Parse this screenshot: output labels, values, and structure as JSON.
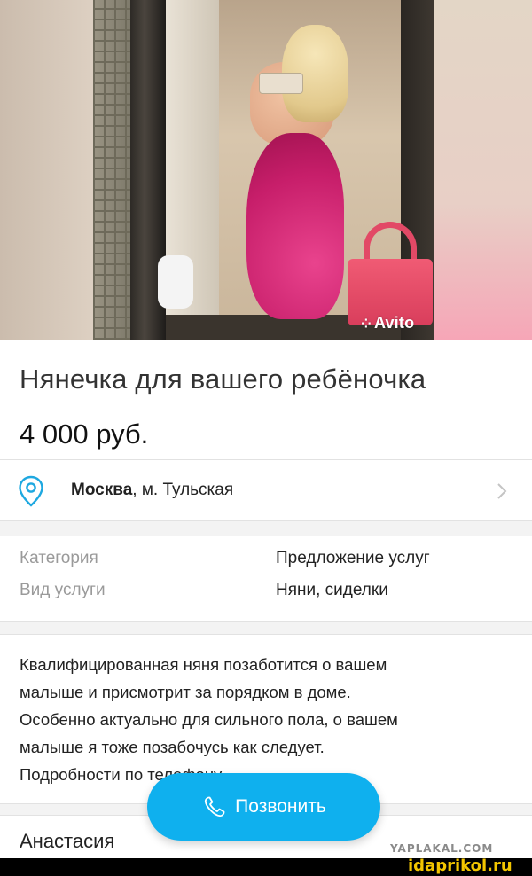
{
  "photo": {
    "watermark": "Avito",
    "watermark_icon": "avito-dots-icon"
  },
  "listing": {
    "title": "Нянечка для вашего ребёночка",
    "price": "4 000 руб."
  },
  "location": {
    "city": "Москва",
    "metro": ", м. Тульская",
    "icon": "location-pin-icon",
    "chevron_icon": "chevron-right-icon"
  },
  "properties": [
    {
      "label": "Категория",
      "value": "Предложение услуг"
    },
    {
      "label": "Вид услуги",
      "value": "Няни, сиделки"
    }
  ],
  "description": {
    "line1": "Квалифицированная няня позаботится о вашем",
    "line2": "малыше и присмотрит за порядком в доме.",
    "line3": "Особенно актуально для сильного пола, о вашем",
    "line4": "малыше я тоже позабочусь как следует.",
    "line5": "Подробности по телефону"
  },
  "seller": {
    "name": "Анастасия"
  },
  "call_button": {
    "label": "Позвонить",
    "icon": "phone-icon"
  },
  "watermarks": {
    "top": "YAPLAKAL.COM",
    "bottom": "idaprikol.ru"
  },
  "colors": {
    "accent": "#0fb0ee",
    "label_gray": "#9a9a9a",
    "pin_blue": "#1ea8e0",
    "brand_yellow": "#f2c500"
  }
}
